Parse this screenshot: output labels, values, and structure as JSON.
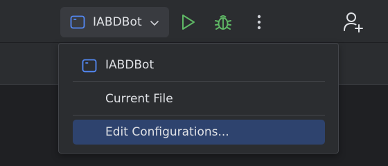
{
  "toolbar": {
    "config_selector": {
      "label": "IABDBot",
      "icon": "app-window-icon",
      "dropdown_icon": "chevron-down-icon"
    },
    "run_icon": "play-icon",
    "debug_icon": "bug-icon",
    "more_icon": "vertical-dots-icon",
    "add_user_icon": "add-user-icon",
    "colors": {
      "run": "#5fb865",
      "debug": "#5fb865",
      "app_icon": "#548af7"
    }
  },
  "dropdown": {
    "items": [
      {
        "label": "IABDBot",
        "icon": "app-window-icon"
      },
      {
        "label": "Current File"
      },
      {
        "label": "Edit Configurations...",
        "selected": true
      }
    ],
    "colors": {
      "selected_bg": "#2e436e"
    }
  }
}
